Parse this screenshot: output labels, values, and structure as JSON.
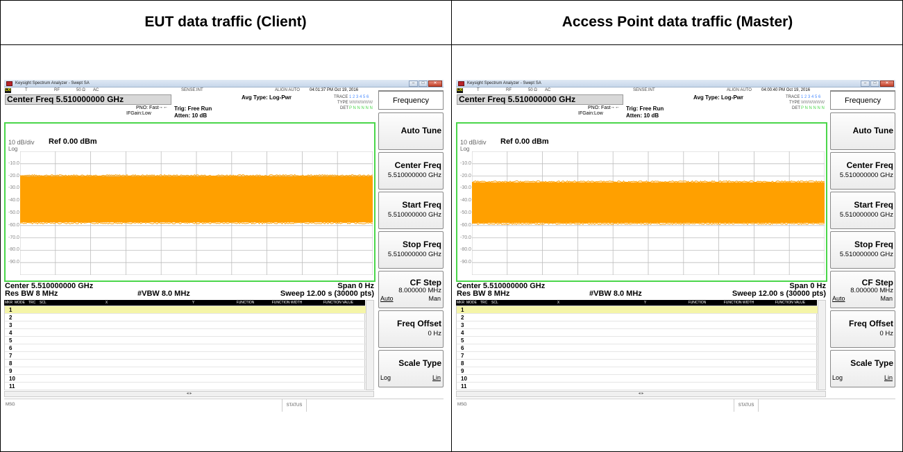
{
  "headers": {
    "left": "EUT data traffic (Client)",
    "right": "Access Point data traffic (Master)"
  },
  "panels": [
    {
      "window_title": "Keysight Spectrum Analyzer - Swept SA",
      "status": {
        "lxi": "LXI",
        "t": "T",
        "rf": "RF",
        "impedance": "50 Ω",
        "coupling": "AC",
        "sense": "SENSE:INT",
        "align": "ALIGN AUTO",
        "timestamp": "04:01:37 PM Oct 19, 2016"
      },
      "center_freq_title": "Center Freq 5.510000000 GHz",
      "avg_type": "Avg Type: Log-Pwr",
      "pno": "PNO: Fast",
      "ifgain": "IFGain:Low",
      "trig": "Trig: Free Run",
      "atten": "Atten: 10 dB",
      "trace_label": "TRACE",
      "trace_nums": "1 2 3 4 5 6",
      "type_label": "TYPE",
      "type_vals": "WWWWWW",
      "det_label": "DET",
      "det_vals": "P N N N N N",
      "scale": "10 dB/div",
      "ref": "Ref 0.00 dBm",
      "log": "Log",
      "y_ticks": [
        "-10.0",
        "-20.0",
        "-30.0",
        "-40.0",
        "-50.0",
        "-60.0",
        "-70.0",
        "-80.0",
        "-90.0"
      ],
      "trace_band": {
        "top_dbm": -19.5,
        "bottom_dbm": -58.0
      },
      "bottom": {
        "center": "Center 5.510000000 GHz",
        "span": "Span 0 Hz",
        "res_bw": "Res BW 8 MHz",
        "vbw": "#VBW 8.0 MHz",
        "sweep": "Sweep  12.00 s (30000 pts)"
      },
      "marker_headers": [
        "MKR",
        "MODE",
        "TRC",
        "SCL",
        "X",
        "Y",
        "FUNCTION",
        "FUNCTION WIDTH",
        "FUNCTION VALUE"
      ],
      "marker_rows": [
        "1",
        "2",
        "3",
        "4",
        "5",
        "6",
        "7",
        "8",
        "9",
        "10",
        "11"
      ],
      "msg": "MSG",
      "status_label": "STATUS",
      "softkeys": {
        "title": "Frequency",
        "auto_tune": "Auto Tune",
        "center_freq": "Center Freq",
        "center_freq_val": "5.510000000 GHz",
        "start_freq": "Start Freq",
        "start_freq_val": "5.510000000 GHz",
        "stop_freq": "Stop Freq",
        "stop_freq_val": "5.510000000 GHz",
        "cf_step": "CF Step",
        "cf_step_val": "8.000000 MHz",
        "auto": "Auto",
        "man": "Man",
        "freq_offset": "Freq Offset",
        "freq_offset_val": "0 Hz",
        "scale_type": "Scale Type",
        "log": "Log",
        "lin": "Lin"
      }
    },
    {
      "window_title": "Keysight Spectrum Analyzer - Swept SA",
      "status": {
        "lxi": "LXI",
        "t": "T",
        "rf": "RF",
        "impedance": "50 Ω",
        "coupling": "AC",
        "sense": "SENSE:INT",
        "align": "ALIGN AUTO",
        "timestamp": "04:00:40 PM Oct 19, 2016"
      },
      "center_freq_title": "Center Freq 5.510000000 GHz",
      "avg_type": "Avg Type: Log-Pwr",
      "pno": "PNO: Fast",
      "ifgain": "IFGain:Low",
      "trig": "Trig: Free Run",
      "atten": "Atten: 10 dB",
      "trace_label": "TRACE",
      "trace_nums": "1 2 3 4 5 6",
      "type_label": "TYPE",
      "type_vals": "WWWWWW",
      "det_label": "DET",
      "det_vals": "P N N N N N",
      "scale": "10 dB/div",
      "ref": "Ref 0.00 dBm",
      "log": "Log",
      "y_ticks": [
        "-10.0",
        "-20.0",
        "-30.0",
        "-40.0",
        "-50.0",
        "-60.0",
        "-70.0",
        "-80.0",
        "-90.0"
      ],
      "trace_band": {
        "top_dbm": -24.5,
        "bottom_dbm": -58.5
      },
      "bottom": {
        "center": "Center 5.510000000 GHz",
        "span": "Span 0 Hz",
        "res_bw": "Res BW 8 MHz",
        "vbw": "#VBW 8.0 MHz",
        "sweep": "Sweep  12.00 s (30000 pts)"
      },
      "marker_headers": [
        "MKR",
        "MODE",
        "TRC",
        "SCL",
        "X",
        "Y",
        "FUNCTION",
        "FUNCTION WIDTH",
        "FUNCTION VALUE"
      ],
      "marker_rows": [
        "1",
        "2",
        "3",
        "4",
        "5",
        "6",
        "7",
        "8",
        "9",
        "10",
        "11"
      ],
      "msg": "MSG",
      "status_label": "STATUS",
      "softkeys": {
        "title": "Frequency",
        "auto_tune": "Auto Tune",
        "center_freq": "Center Freq",
        "center_freq_val": "5.510000000 GHz",
        "start_freq": "Start Freq",
        "start_freq_val": "5.510000000 GHz",
        "stop_freq": "Stop Freq",
        "stop_freq_val": "5.510000000 GHz",
        "cf_step": "CF Step",
        "cf_step_val": "8.000000 MHz",
        "auto": "Auto",
        "man": "Man",
        "freq_offset": "Freq Offset",
        "freq_offset_val": "0 Hz",
        "scale_type": "Scale Type",
        "log": "Log",
        "lin": "Lin"
      }
    }
  ],
  "colors": {
    "trace": "#ffa000",
    "graticule_border": "#4ad64a",
    "marker_header_bg": "#000000"
  }
}
